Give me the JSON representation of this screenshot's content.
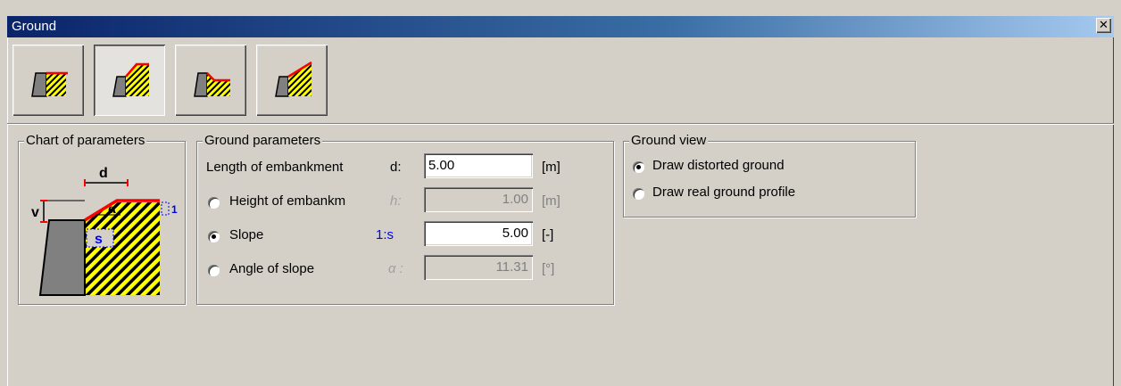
{
  "window": {
    "title": "Ground",
    "close_icon": "close-icon"
  },
  "toolbar": {
    "buttons": [
      {
        "name": "flat-ground",
        "pressed": false
      },
      {
        "name": "embankment",
        "pressed": true
      },
      {
        "name": "depression",
        "pressed": false
      },
      {
        "name": "sloped-ground",
        "pressed": false
      }
    ]
  },
  "chart_panel": {
    "title": "Chart of parameters",
    "labels": {
      "d": "d",
      "v": "v",
      "s": "s",
      "alpha": "α",
      "one": "1"
    }
  },
  "params": {
    "title": "Ground parameters",
    "length": {
      "label": "Length of embankment",
      "symbol": "d:",
      "value": "5.00",
      "unit": "[m]"
    },
    "height": {
      "label": "Height of embankm",
      "symbol": "h:",
      "value": "1.00",
      "unit": "[m]",
      "checked": false
    },
    "slope": {
      "label": "Slope",
      "symbol": "1:s",
      "value": "5.00",
      "unit": "[-]",
      "checked": true
    },
    "angle": {
      "label": "Angle of slope",
      "symbol": "α :",
      "value": "11.31",
      "unit": "[°]",
      "checked": false
    }
  },
  "view": {
    "title": "Ground view",
    "distorted": {
      "label": "Draw distorted ground",
      "checked": true
    },
    "real": {
      "label": "Draw real ground profile",
      "checked": false
    }
  }
}
